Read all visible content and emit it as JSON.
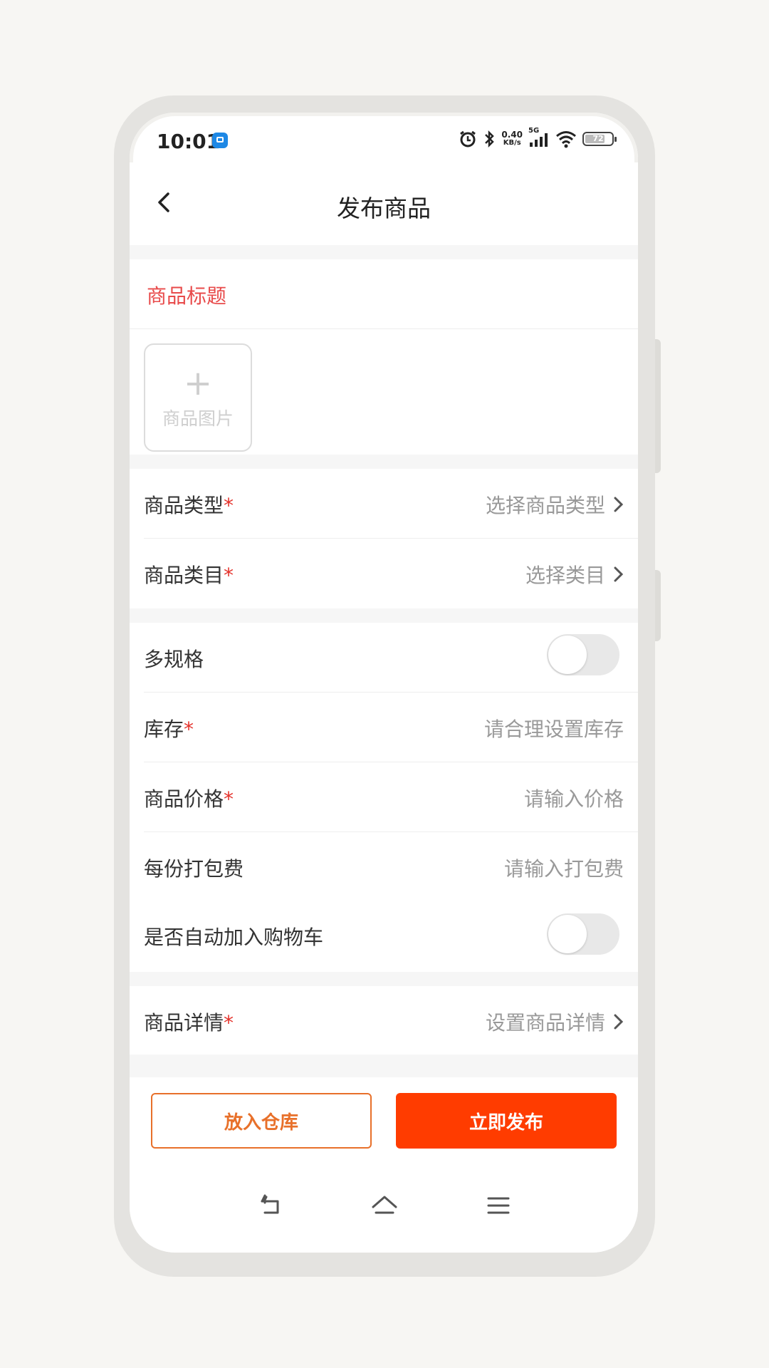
{
  "status_bar": {
    "time": "10:01",
    "net_speed_top": "0.40",
    "net_speed_bottom": "KB/s",
    "network": "5G",
    "battery": "72"
  },
  "header": {
    "title": "发布商品"
  },
  "product_title": {
    "placeholder": "商品标题"
  },
  "photo_upload": {
    "plus": "+",
    "label": "商品图片"
  },
  "fields": {
    "type": {
      "label": "商品类型",
      "required": "*",
      "value": "选择商品类型"
    },
    "category": {
      "label": "商品类目",
      "required": "*",
      "value": "选择类目"
    },
    "multi_spec": {
      "label": "多规格",
      "on": false
    },
    "stock": {
      "label": "库存",
      "required": "*",
      "placeholder": "请合理设置库存"
    },
    "price": {
      "label": "商品价格",
      "required": "*",
      "placeholder": "请输入价格"
    },
    "packing_fee": {
      "label": "每份打包费",
      "placeholder": "请输入打包费"
    },
    "auto_cart": {
      "label": "是否自动加入购物车",
      "on": false
    },
    "detail": {
      "label": "商品详情",
      "required": "*",
      "value": "设置商品详情"
    }
  },
  "actions": {
    "warehouse": "放入仓库",
    "publish": "立即发布"
  },
  "colors": {
    "accent": "#ff3c00",
    "outline_button": "#e8702a",
    "required": "#e4322b",
    "title_placeholder": "#e84a4a"
  }
}
